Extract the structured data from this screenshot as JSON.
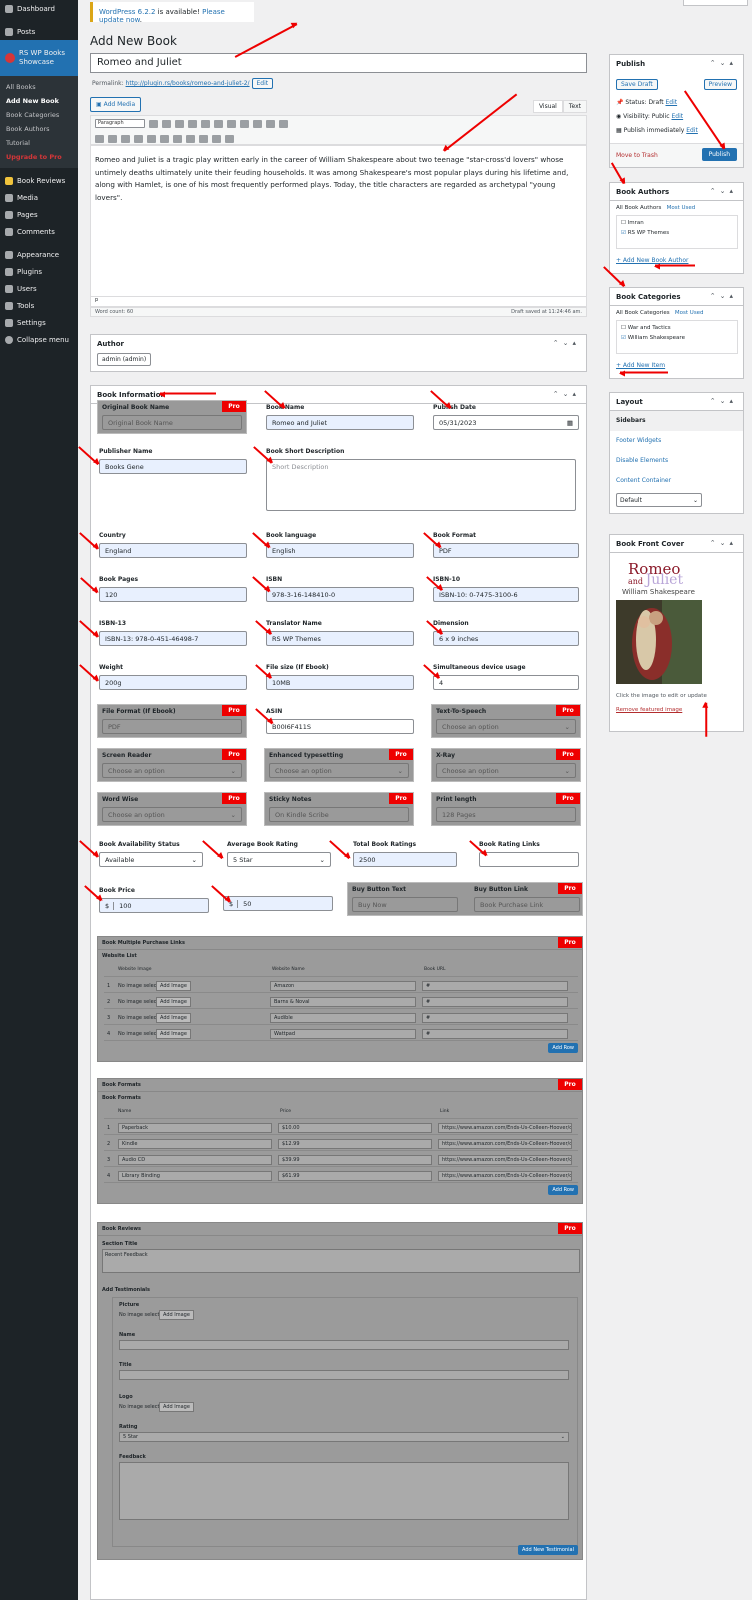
{
  "sidebar": {
    "items": [
      {
        "label": "Dashboard"
      },
      {
        "label": "Posts"
      },
      {
        "label": "RS WP Books Showcase"
      },
      {
        "label": "Book Reviews"
      },
      {
        "label": "Media"
      },
      {
        "label": "Pages"
      },
      {
        "label": "Comments"
      },
      {
        "label": "Appearance"
      },
      {
        "label": "Plugins"
      },
      {
        "label": "Users"
      },
      {
        "label": "Tools"
      },
      {
        "label": "Settings"
      },
      {
        "label": "Collapse menu"
      }
    ],
    "submenu": [
      "All Books",
      "Add New Book",
      "Book Categories",
      "Book Authors",
      "Tutorial",
      "Upgrade to Pro"
    ]
  },
  "notice": {
    "version_text": "WordPress 6.2.2",
    "rest": " is available! ",
    "link": "Please update now",
    "end": "."
  },
  "page_title": "Add New Book",
  "post_title": "Romeo and Juliet",
  "permalink": {
    "label": "Permalink:",
    "url": "http://plugin.rs/books/romeo-and-juliet-2/",
    "edit": "Edit"
  },
  "editor": {
    "add_media": "Add Media",
    "tab_visual": "Visual",
    "tab_text": "Text",
    "format": "Paragraph",
    "content": "Romeo and Juliet is a tragic play written early in the career of William Shakespeare about two teenage \"star-cross'd lovers\" whose untimely deaths ultimately unite their feuding households. It was among Shakespeare's most popular plays during his lifetime and, along with Hamlet, is one of his most frequently performed plays. Today, the title characters are regarded as archetypal \"young lovers\".",
    "path": "p",
    "word_count": "Word count: 60",
    "draft_saved": "Draft saved at 11:24:46 am."
  },
  "author_box": {
    "title": "Author",
    "value": "admin (admin)"
  },
  "book_info": {
    "title": "Book Information",
    "original_name": {
      "label": "Original Book Name",
      "placeholder": "Original Book Name"
    },
    "book_name": {
      "label": "Book Name",
      "value": "Romeo and Juliet"
    },
    "publish_date": {
      "label": "Publish Date",
      "value": "05/31/2023"
    },
    "publisher": {
      "label": "Publisher Name",
      "value": "Books Gene"
    },
    "short_desc": {
      "label": "Book Short Description",
      "placeholder": "Short Description"
    },
    "country": {
      "label": "Country",
      "value": "England"
    },
    "language": {
      "label": "Book language",
      "value": "English"
    },
    "format": {
      "label": "Book Format",
      "value": "PDF"
    },
    "pages": {
      "label": "Book Pages",
      "value": "120"
    },
    "isbn": {
      "label": "ISBN",
      "value": "978-3-16-148410-0"
    },
    "isbn10": {
      "label": "ISBN-10",
      "value": "ISBN-10: 0-7475-3100-6"
    },
    "isbn13": {
      "label": "ISBN-13",
      "value": "ISBN-13: 978-0-451-46498-7"
    },
    "translator": {
      "label": "Translator Name",
      "value": "RS WP Themes"
    },
    "dimension": {
      "label": "Dimension",
      "value": "6 x 9 inches"
    },
    "weight": {
      "label": "Weight",
      "value": "200g"
    },
    "filesize": {
      "label": "File size (If Ebook)",
      "value": "10MB"
    },
    "devices": {
      "label": "Simultaneous device usage",
      "value": "4"
    },
    "file_format": {
      "label": "File Format (If Ebook)",
      "value": "PDF"
    },
    "asin": {
      "label": "ASIN",
      "value": "B00I6F411S"
    },
    "tts": {
      "label": "Text-To-Speech",
      "value": "Choose an option"
    },
    "screen_reader": {
      "label": "Screen Reader",
      "value": "Choose an option"
    },
    "typesetting": {
      "label": "Enhanced typesetting",
      "value": "Choose an option"
    },
    "xray": {
      "label": "X-Ray",
      "value": "Choose an option"
    },
    "word_wise": {
      "label": "Word Wise",
      "value": "Choose an option"
    },
    "sticky": {
      "label": "Sticky Notes",
      "value": "On Kindle Scribe"
    },
    "print_length": {
      "label": "Print length",
      "value": "128 Pages"
    },
    "availability": {
      "label": "Book Availability Status",
      "value": "Available"
    },
    "avg_rating": {
      "label": "Average Book Rating",
      "value": "5 Star"
    },
    "total_ratings": {
      "label": "Total Book Ratings",
      "value": "2500"
    },
    "rating_links": {
      "label": "Book Rating Links",
      "value": ""
    },
    "price": {
      "label": "Book Price",
      "currency": "$",
      "value": "100"
    },
    "price2": {
      "currency": "$",
      "value": "50"
    },
    "buy_text": {
      "label": "Buy Button Text",
      "placeholder": "Buy Now"
    },
    "buy_link": {
      "label": "Buy Button Link",
      "placeholder": "Book Purchase Link"
    },
    "pro": "Pro"
  },
  "purchase_links": {
    "title": "Book Multiple Purchase Links",
    "sub": "Website List",
    "cols": [
      "Website Image",
      "Website Name",
      "Book URL"
    ],
    "rows": [
      {
        "n": "1",
        "img": "No image selected",
        "btn": "Add Image",
        "name": "Amazon",
        "url": "#"
      },
      {
        "n": "2",
        "img": "No image selected",
        "btn": "Add Image",
        "name": "Barns & Noval",
        "url": "#"
      },
      {
        "n": "3",
        "img": "No image selected",
        "btn": "Add Image",
        "name": "Audible",
        "url": "#"
      },
      {
        "n": "4",
        "img": "No image selected",
        "btn": "Add Image",
        "name": "Wattpad",
        "url": "#"
      }
    ],
    "add": "Add Row"
  },
  "book_formats": {
    "title": "Book Formats",
    "sub": "Book Formats",
    "cols": [
      "Name",
      "Price",
      "Link"
    ],
    "rows": [
      {
        "n": "1",
        "name": "Paperback",
        "price": "$10.00",
        "link": "https://www.amazon.com/Ends-Us-Colleen-Hoover/dp"
      },
      {
        "n": "2",
        "name": "Kindle",
        "price": "$12.99",
        "link": "https://www.amazon.com/Ends-Us-Colleen-Hoover/dp"
      },
      {
        "n": "3",
        "name": "Audio CD",
        "price": "$39.99",
        "link": "https://www.amazon.com/Ends-Us-Colleen-Hoover/dp"
      },
      {
        "n": "4",
        "name": "Library Binding",
        "price": "$61.99",
        "link": "https://www.amazon.com/Ends-Us-Colleen-Hoover/dp"
      }
    ],
    "add": "Add Row"
  },
  "reviews": {
    "title": "Book Reviews",
    "section_title": "Section Title",
    "section_value": "Recent Feedback",
    "add_testimonials": "Add Testimonials",
    "picture": "Picture",
    "no_image": "No image selected",
    "add_image": "Add Image",
    "name": "Name",
    "title_lbl": "Title",
    "logo": "Logo",
    "rating": "Rating",
    "rating_value": "5 Star",
    "feedback": "Feedback",
    "add_btn": "Add New Testimonial"
  },
  "publish": {
    "title": "Publish",
    "save": "Save Draft",
    "preview": "Preview",
    "status": "Status: Draft",
    "visibility": "Visibility: Public",
    "immediately": "Publish immediately",
    "edit": "Edit",
    "trash": "Move to Trash",
    "publish": "Publish"
  },
  "book_authors": {
    "title": "Book Authors",
    "tab_all": "All Book Authors",
    "tab_used": "Most Used",
    "items": [
      {
        "label": "Imran",
        "checked": false
      },
      {
        "label": "RS WP Themes",
        "checked": true
      }
    ],
    "add": "+ Add New Book Author"
  },
  "book_categories": {
    "title": "Book Categories",
    "tab_all": "All Book Categories",
    "tab_used": "Most Used",
    "items": [
      {
        "label": "War and Tactics",
        "checked": false
      },
      {
        "label": "William Shakespeare",
        "checked": true
      }
    ],
    "add": "+ Add New Item"
  },
  "layout": {
    "title": "Layout",
    "items": [
      "Sidebars",
      "Footer Widgets",
      "Disable Elements",
      "Content Container"
    ],
    "select": "Default"
  },
  "front_cover": {
    "title": "Book Front Cover",
    "cover_title1": "Romeo",
    "cover_and": "and",
    "cover_title2": "Juliet",
    "cover_author": "William Shakespeare",
    "hint": "Click the image to edit or update",
    "remove": "Remove featured image"
  },
  "colors": {
    "wp_blue": "#2271b1",
    "admin_dark": "#1d2327",
    "pro_red": "#e00000",
    "arrow_red": "#e00000"
  }
}
